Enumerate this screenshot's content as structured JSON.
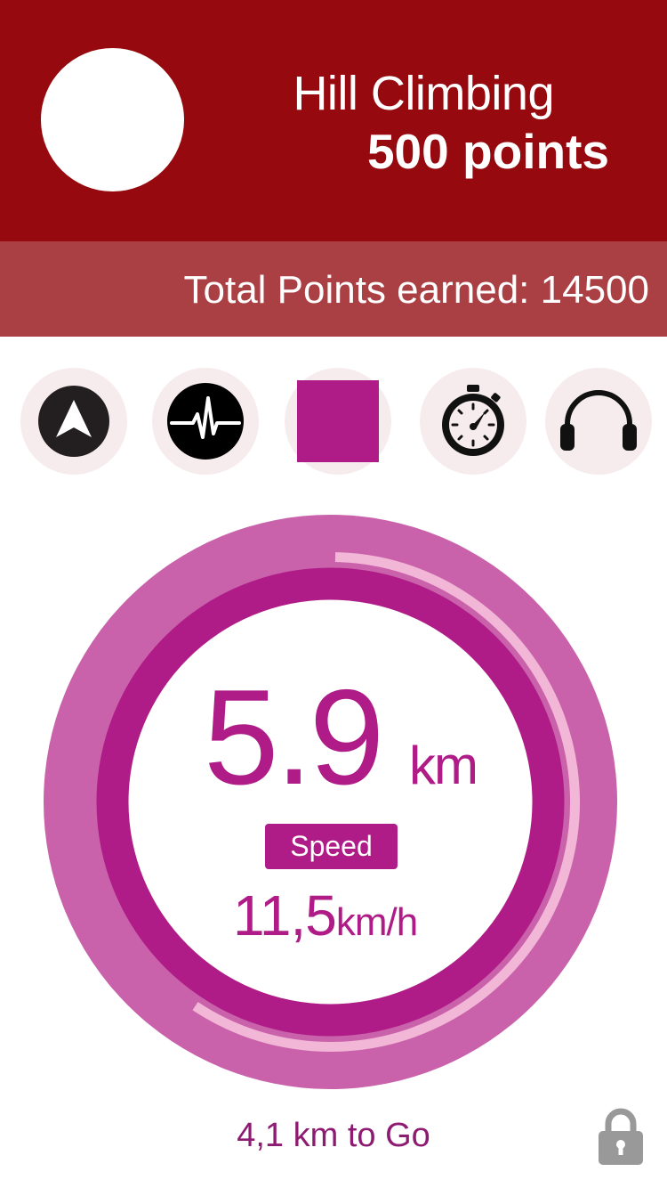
{
  "challenge": {
    "title": "Hill Climbing",
    "points": "500 points"
  },
  "total": {
    "text": "Total Points earned: 14500"
  },
  "controls": [
    {
      "name": "navigation",
      "icon": "navigation-arrow-icon"
    },
    {
      "name": "heart-rate",
      "icon": "heart-rate-icon"
    },
    {
      "name": "stop",
      "icon": "stop-square-icon"
    },
    {
      "name": "stopwatch",
      "icon": "stopwatch-icon"
    },
    {
      "name": "music",
      "icon": "headphones-icon"
    }
  ],
  "workout": {
    "distance_value": "5.9",
    "distance_unit": "km",
    "speed_label": "Speed",
    "speed_value": "11,5",
    "speed_unit": "km/h",
    "remaining": "4,1 km to Go",
    "progress_fraction": 0.59
  },
  "colors": {
    "header": "#960a0f",
    "total_bar": "#aa4044",
    "accent": "#b01c87",
    "outer_ring": "#c962ab",
    "progress_track": "#f2b6d6",
    "control_bg": "#f6eced"
  }
}
